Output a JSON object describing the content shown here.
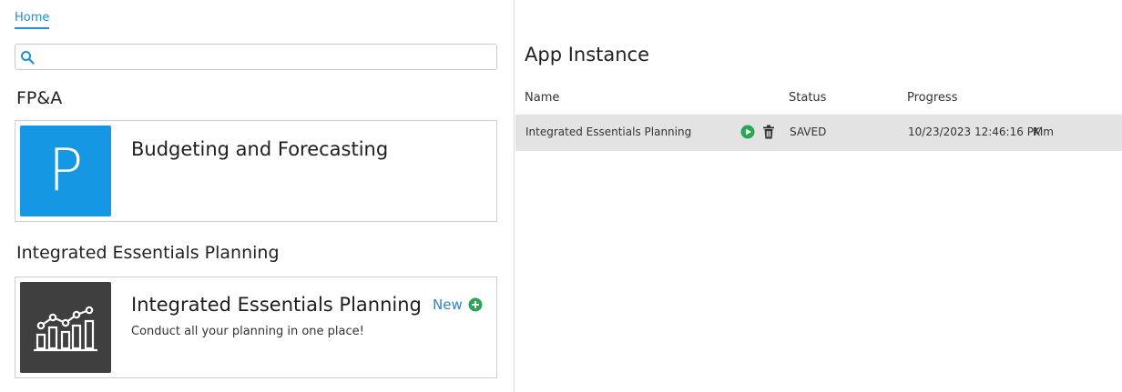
{
  "breadcrumb": {
    "home": "Home"
  },
  "search": {
    "value": "",
    "placeholder": ""
  },
  "sections": [
    {
      "title": "FP&A",
      "card": {
        "tile_letter": "P",
        "tile_color": "#1597e3",
        "title": "Budgeting and Forecasting"
      }
    },
    {
      "title": "Integrated Essentials Planning",
      "card": {
        "tile_icon": "bar-line-chart-icon",
        "tile_color": "#3f3f3f",
        "title": "Integrated Essentials Planning",
        "description": "Conduct all your planning in one place!",
        "new_label": "New",
        "new_icon": "plus-circle-icon",
        "new_icon_color": "#2aa756"
      }
    }
  ],
  "app_instance": {
    "title": "App Instance",
    "columns": [
      "Name",
      "Status",
      "Progress"
    ],
    "rows": [
      {
        "name": "Integrated Essentials Planning",
        "run_icon": "play-circle-icon",
        "run_icon_color": "#2aa756",
        "delete_icon": "trash-icon",
        "status": "SAVED",
        "progress": "10/23/2023 12:46:16 PM",
        "user": "Kim"
      }
    ]
  },
  "colors": {
    "accent": "#1f8fd6",
    "row_highlight": "#e3e3e3"
  }
}
